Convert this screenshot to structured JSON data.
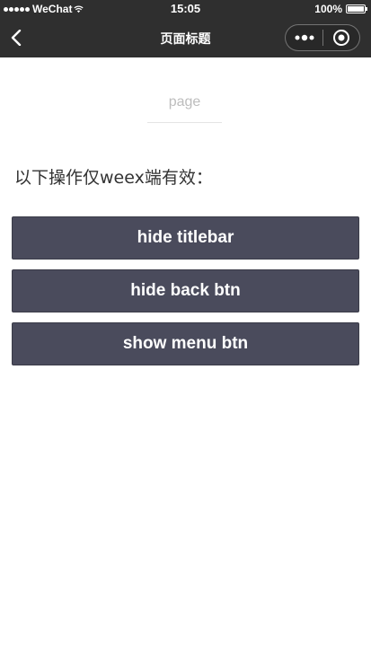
{
  "status_bar": {
    "carrier": "WeChat",
    "time": "15:05",
    "battery_percent": "100%",
    "battery_level": 1.0
  },
  "nav_bar": {
    "title": "页面标题",
    "back_icon": "chevron-left-icon",
    "more_icon": "more-dots-icon",
    "close_icon": "target-circle-icon",
    "background_color": "#2f2f2f"
  },
  "content": {
    "page_label": "page",
    "notice": "以下操作仅weex端有效："
  },
  "buttons": [
    {
      "label": "hide titlebar"
    },
    {
      "label": "hide back btn"
    },
    {
      "label": "show menu btn"
    }
  ],
  "colors": {
    "button_background": "#4a4b5c",
    "button_text": "#ffffff",
    "page_label": "#bdbdbd"
  }
}
